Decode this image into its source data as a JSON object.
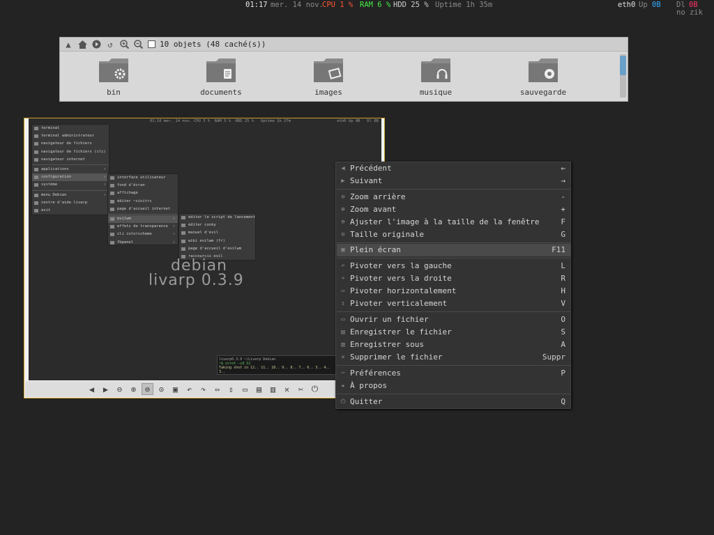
{
  "topbar": {
    "time": "01:17",
    "date": "mer. 14 nov.",
    "cpu": "CPU 1 %",
    "ram": "RAM 6 %",
    "hdd": "HDD 25 %",
    "uptime": "Uptime 1h 35m",
    "net_if": "eth0",
    "net_up_label": "Up",
    "net_up_val": "0B",
    "net_dl_label": "Dl",
    "net_dl_val": "0B",
    "music": "no zik"
  },
  "colors": {
    "cpu": "#ff5533",
    "ram": "#44ee44",
    "up": "#33aaff",
    "dl": "#ff3366"
  },
  "file_manager": {
    "status": "10 objets (48 caché(s))",
    "folders": [
      {
        "label": "bin",
        "icon": "gear-icon"
      },
      {
        "label": "documents",
        "icon": "document-icon"
      },
      {
        "label": "images",
        "icon": "picture-icon"
      },
      {
        "label": "musique",
        "icon": "headphones-icon"
      },
      {
        "label": "sauvegarde",
        "icon": "disc-icon"
      }
    ]
  },
  "shot": {
    "topbar": "01:10 mer. 14 nov. CPU 3 %  RAM 3 %  HDD 25 %   Uptime 1h 27m                    eth0 Up 0B   Dl 0B",
    "main_menu": [
      "terminal",
      "terminal administrateur",
      "navigateur de fichiers",
      "navigateur de fichiers (cli)",
      "navigateur internet",
      "applications",
      "configuration",
      "système",
      "menu Debian",
      "centre d'aide livarp",
      "exit"
    ],
    "config_menu": [
      "interface utilisateur",
      "fond d'écran",
      "affichage",
      "éditer ~xinitrc",
      "page d'accueil internet",
      "evilwm",
      "effets de transparence",
      "cli colorscheme",
      "fbpanel"
    ],
    "evilwm_menu": [
      "éditer le script de lancement",
      "éditer conky",
      "manuel d'evil",
      "wiki evilwm (fr)",
      "page d'accueil d'evilwm",
      "raccourcis evil"
    ],
    "logo_line1": "debian",
    "logo_line2": "livarp 0.3.9",
    "term_lines": [
      "livarp0.3.9 ~/Livarp Debian",
      "~$ scrot -cd 12",
      "Taking shot in 12.. 11.. 10.. 9.. 8.. 7.. 6.. 5.. 4.. 3.."
    ]
  },
  "context_menu": {
    "items": [
      {
        "label": "Précédent",
        "key": "←",
        "icon": "back-icon"
      },
      {
        "label": "Suivant",
        "key": "→",
        "icon": "forward-icon"
      },
      {
        "label": "Zoom arrière",
        "key": "-",
        "icon": "zoom-out-icon"
      },
      {
        "label": "Zoom avant",
        "key": "+",
        "icon": "zoom-in-icon"
      },
      {
        "label": "Ajuster l'image à la taille de la fenêtre",
        "key": "F",
        "icon": "zoom-fit-icon"
      },
      {
        "label": "Taille originale",
        "key": "G",
        "icon": "zoom-original-icon"
      },
      {
        "label": "Plein écran",
        "key": "F11",
        "icon": "fullscreen-icon"
      },
      {
        "label": "Pivoter vers la gauche",
        "key": "L",
        "icon": "rotate-left-icon"
      },
      {
        "label": "Pivoter vers la droite",
        "key": "R",
        "icon": "rotate-right-icon"
      },
      {
        "label": "Pivoter horizontalement",
        "key": "H",
        "icon": "flip-horizontal-icon"
      },
      {
        "label": "Pivoter verticalement",
        "key": "V",
        "icon": "flip-vertical-icon"
      },
      {
        "label": "Ouvrir un fichier",
        "key": "O",
        "icon": "open-icon"
      },
      {
        "label": "Enregistrer le fichier",
        "key": "S",
        "icon": "save-icon"
      },
      {
        "label": "Enregistrer sous",
        "key": "A",
        "icon": "save-as-icon"
      },
      {
        "label": "Supprimer le fichier",
        "key": "Suppr",
        "icon": "delete-icon"
      },
      {
        "label": "Préférences",
        "key": "P",
        "icon": "preferences-icon"
      },
      {
        "label": "À propos",
        "key": "",
        "icon": "about-icon"
      },
      {
        "label": "Quitter",
        "key": "Q",
        "icon": "quit-icon"
      }
    ]
  }
}
